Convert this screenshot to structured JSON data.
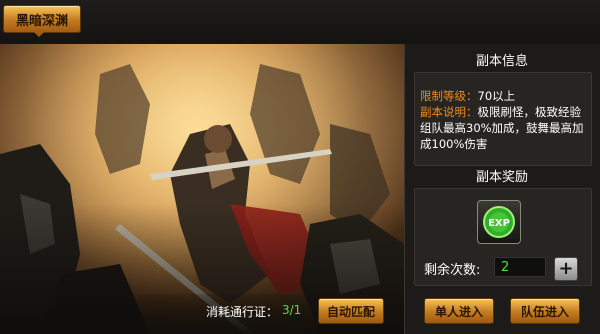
{
  "header": {
    "tab_label": "黑暗深渊"
  },
  "footer": {
    "pass_label": "消耗通行证：",
    "pass_count": "3/1",
    "auto_match_label": "自动匹配"
  },
  "info_panel": {
    "title": "副本信息",
    "level_label": "限制等级：",
    "level_value": "70以上",
    "desc_label": "副本说明：",
    "desc_line1": "极限刷怪，极致经验",
    "desc_line2": "组队最高30%加成，鼓舞最高加",
    "desc_line3": "成100%伤害"
  },
  "reward_panel": {
    "title": "副本奖励",
    "reward_icon": "exp-icon",
    "reward_icon_text": "EXP",
    "attempts_label": "剩余次数:",
    "attempts_value": "2",
    "plus_symbol": "+"
  },
  "actions": {
    "solo_label": "单人进入",
    "team_label": "队伍进入"
  },
  "colors": {
    "orange_label": "#f08a1c",
    "green_value": "#4fe03a",
    "gold_button": "#c27b1f"
  }
}
